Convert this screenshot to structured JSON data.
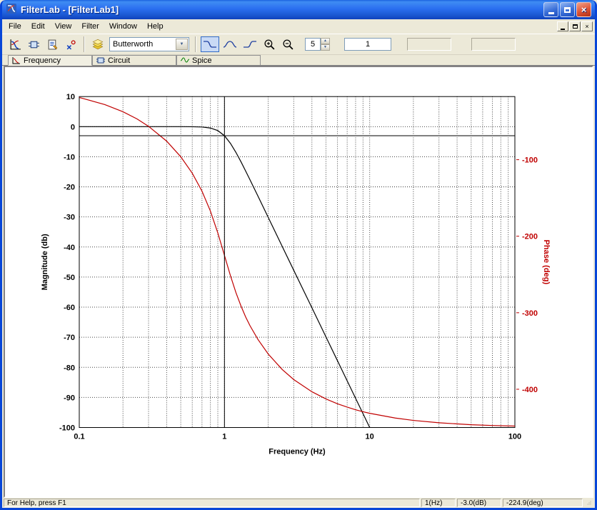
{
  "window": {
    "title": "FilterLab - [FilterLab1]"
  },
  "menu": {
    "items": [
      {
        "label": "File"
      },
      {
        "label": "Edit"
      },
      {
        "label": "View"
      },
      {
        "label": "Filter"
      },
      {
        "label": "Window"
      },
      {
        "label": "Help"
      }
    ]
  },
  "toolbar": {
    "approximation_select": {
      "value": "Butterworth"
    },
    "order_spinner": {
      "value": "5"
    },
    "frequency_input": {
      "value": "1"
    }
  },
  "tabs": [
    {
      "label": "Frequency",
      "selected": true
    },
    {
      "label": "Circuit",
      "selected": false
    },
    {
      "label": "Spice",
      "selected": false
    }
  ],
  "statusbar": {
    "help_text": "For Help, press F1",
    "cursor_frequency": "1(Hz)",
    "cursor_magnitude": "-3.0(dB)",
    "cursor_phase": "-224.9(deg)"
  },
  "icons": {
    "combo_arrow": "▼",
    "spin_up": "▲",
    "spin_down": "▼",
    "close": "×"
  },
  "chart_data": {
    "type": "line",
    "title": "",
    "xlabel": "Frequency (Hz)",
    "ylabel_left": "Magnitude (db)",
    "ylabel_right": "Phase (deg)",
    "x_scale": "log",
    "grid": true,
    "legend": false,
    "xlim": [
      0.1,
      100
    ],
    "x_ticks": [
      "0.1",
      "1",
      "10",
      "100"
    ],
    "ylim_left": [
      -100,
      10
    ],
    "y_ticks_left": [
      10,
      0,
      -10,
      -20,
      -30,
      -40,
      -50,
      -60,
      -70,
      -80,
      -90,
      -100
    ],
    "ylim_right": [
      -450,
      -17.5
    ],
    "y_ticks_right": [
      -100,
      -200,
      -300,
      -400
    ],
    "axis_color_left": "#000000",
    "axis_color_right": "#c00000",
    "cursor": {
      "frequency_hz": 1,
      "magnitude_db": -3.0,
      "phase_deg": -224.9
    },
    "series": [
      {
        "name": "magnitude",
        "axis": "left",
        "color": "#000000",
        "points": [
          [
            0.1,
            0
          ],
          [
            0.2,
            0
          ],
          [
            0.3,
            0
          ],
          [
            0.4,
            0
          ],
          [
            0.5,
            -0.004
          ],
          [
            0.6,
            -0.026
          ],
          [
            0.7,
            -0.121
          ],
          [
            0.8,
            -0.441
          ],
          [
            0.9,
            -1.3
          ],
          [
            1.0,
            -3.01
          ],
          [
            1.1,
            -5.56
          ],
          [
            1.2,
            -8.57
          ],
          [
            1.3,
            -11.7
          ],
          [
            1.4,
            -14.76
          ],
          [
            1.5,
            -17.67
          ],
          [
            1.7,
            -23.07
          ],
          [
            2.0,
            -30.11
          ],
          [
            2.5,
            -39.79
          ],
          [
            3.0,
            -47.72
          ],
          [
            4.0,
            -60.21
          ],
          [
            5.0,
            -69.9
          ],
          [
            6.0,
            -77.82
          ],
          [
            7.0,
            -84.51
          ],
          [
            8.0,
            -90.31
          ],
          [
            9.0,
            -95.42
          ],
          [
            10.0,
            -100.0
          ]
        ]
      },
      {
        "name": "phase",
        "axis": "right",
        "color": "#c00000",
        "points": [
          [
            0.1,
            -18.6
          ],
          [
            0.15,
            -28.0
          ],
          [
            0.2,
            -37.3
          ],
          [
            0.25,
            -46.7
          ],
          [
            0.3,
            -56.3
          ],
          [
            0.4,
            -75.8
          ],
          [
            0.5,
            -96.1
          ],
          [
            0.6,
            -117.6
          ],
          [
            0.7,
            -141.0
          ],
          [
            0.8,
            -167.0
          ],
          [
            0.9,
            -195.7
          ],
          [
            1.0,
            -225.0
          ],
          [
            1.1,
            -251.6
          ],
          [
            1.2,
            -273.7
          ],
          [
            1.3,
            -291.3
          ],
          [
            1.4,
            -305.5
          ],
          [
            1.5,
            -317.0
          ],
          [
            1.7,
            -334.9
          ],
          [
            2.0,
            -353.8
          ],
          [
            2.5,
            -374.2
          ],
          [
            3.0,
            -387.3
          ],
          [
            4.0,
            -403.3
          ],
          [
            5.0,
            -412.7
          ],
          [
            6.0,
            -419.0
          ],
          [
            7.0,
            -423.4
          ],
          [
            8.0,
            -426.8
          ],
          [
            9.0,
            -429.4
          ],
          [
            10.0,
            -431.4
          ],
          [
            15.0,
            -437.6
          ],
          [
            20.0,
            -440.7
          ],
          [
            30.0,
            -443.8
          ],
          [
            50.0,
            -446.3
          ],
          [
            70.0,
            -447.4
          ],
          [
            100.0,
            -448.1
          ]
        ]
      }
    ]
  }
}
